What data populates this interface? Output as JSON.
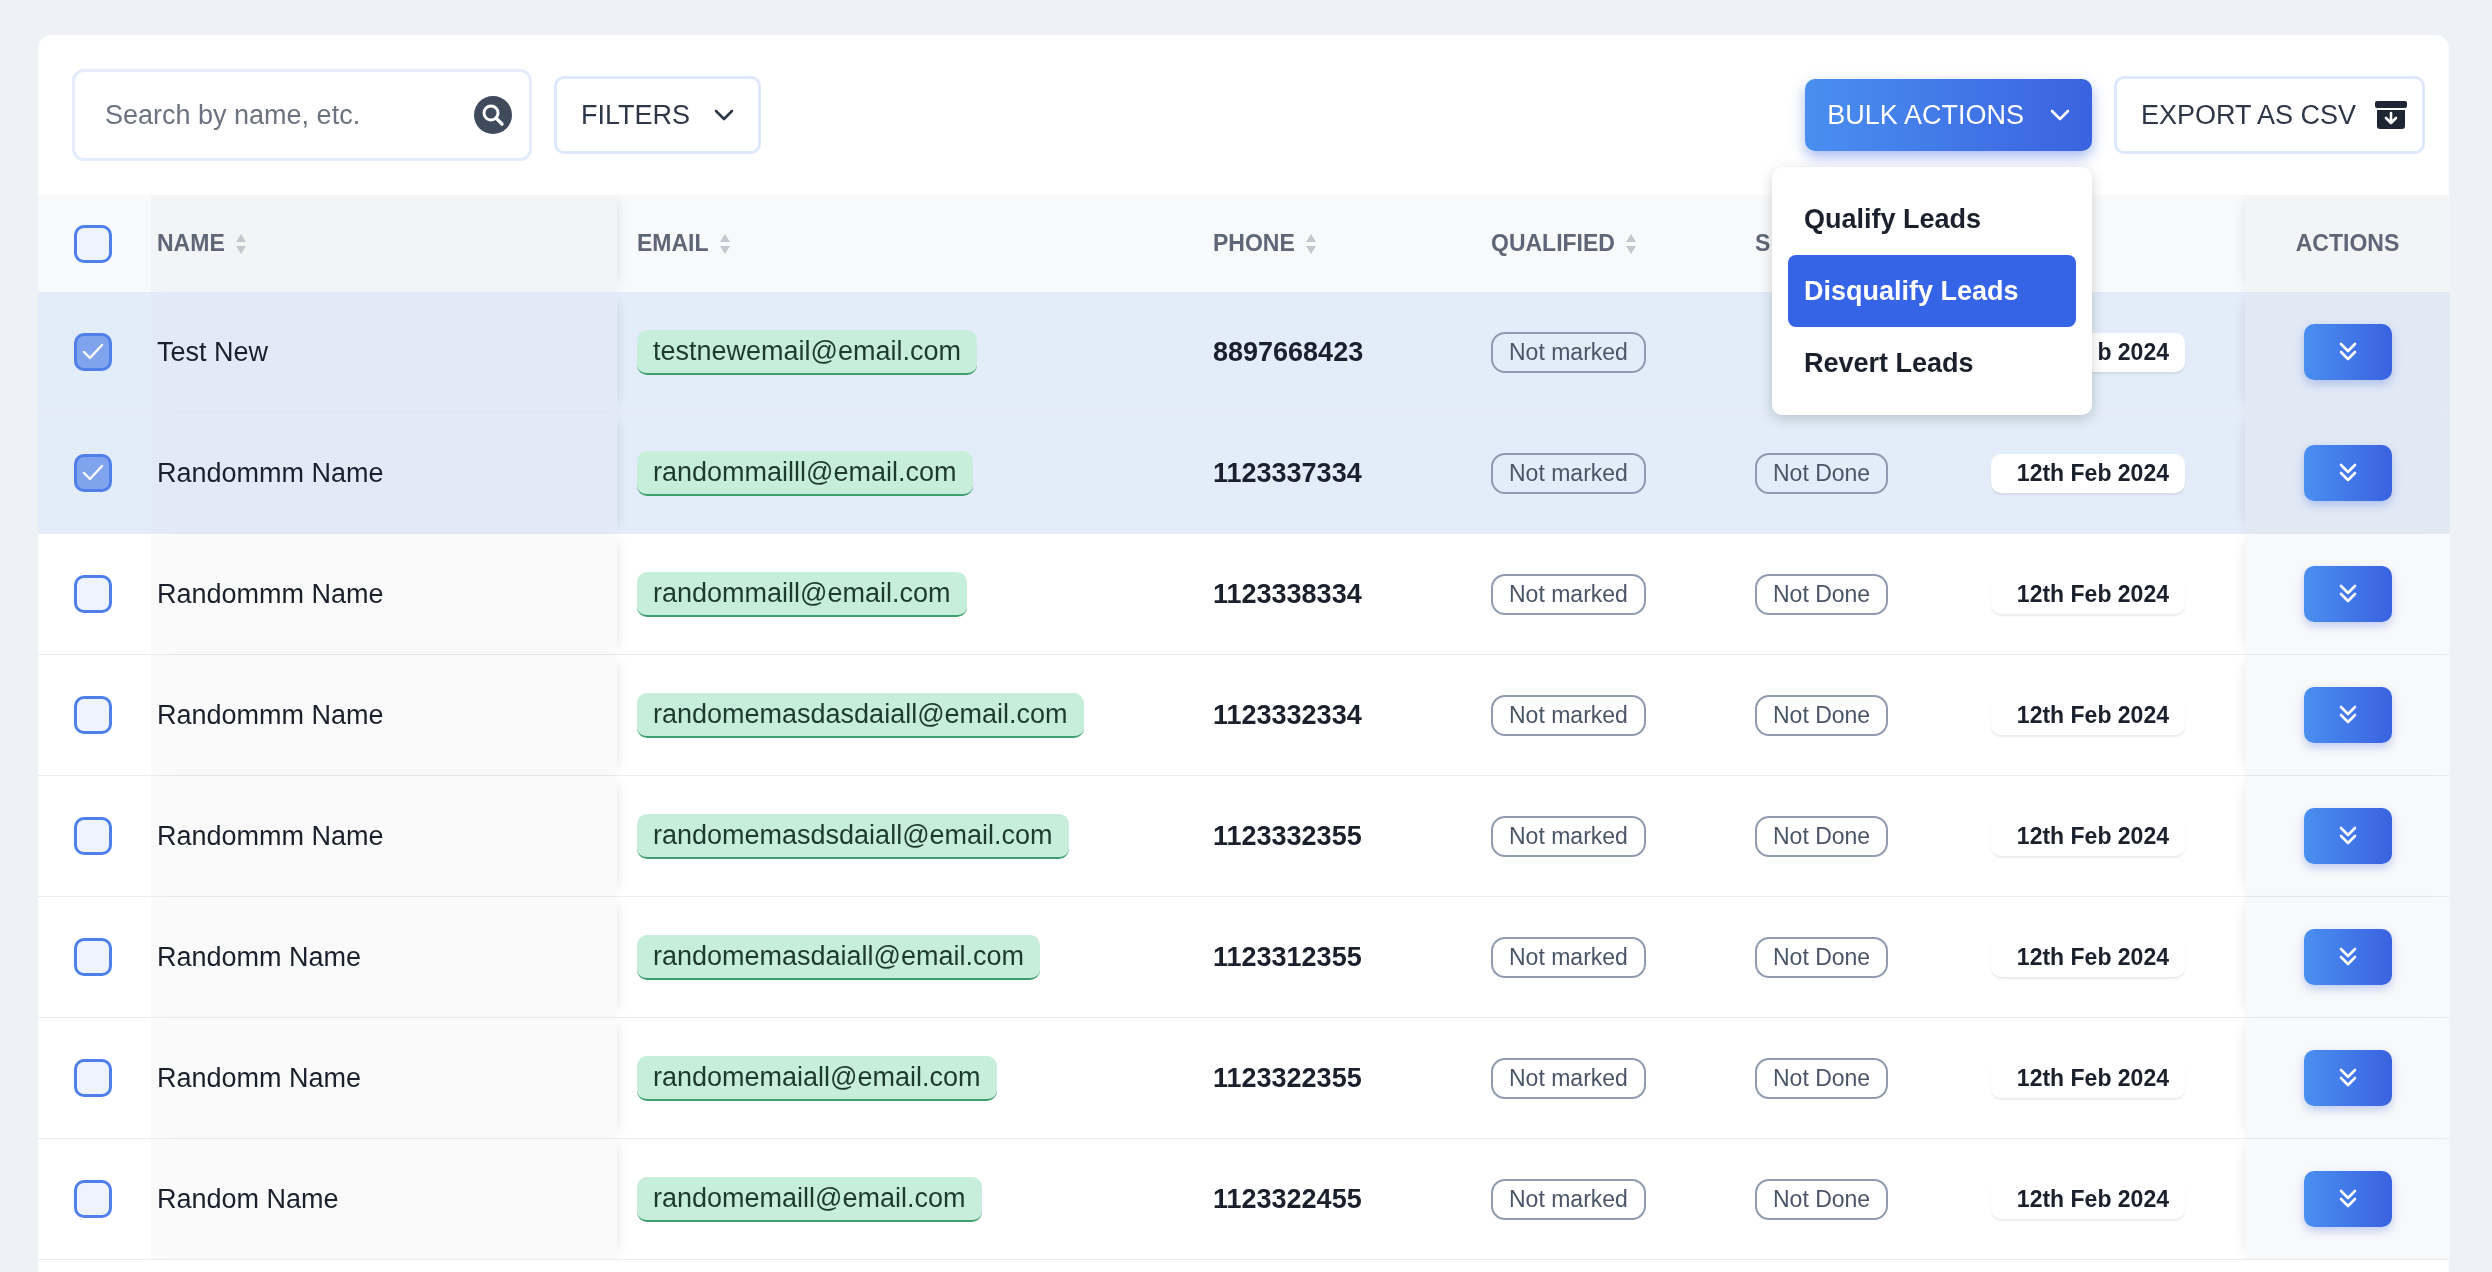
{
  "toolbar": {
    "search": {
      "placeholder": "Search by name, etc."
    },
    "filters_button": "FILTERS",
    "bulk_actions": {
      "label": "BULK ACTIONS",
      "expanded": true,
      "menu": [
        {
          "label": "Qualify Leads",
          "selected": false
        },
        {
          "label": "Disqualify Leads",
          "selected": true
        },
        {
          "label": "Revert Leads",
          "selected": false
        }
      ]
    },
    "export_button": "EXPORT AS CSV"
  },
  "table": {
    "select_all": {
      "checked": false
    },
    "columns": [
      {
        "label": "NAME",
        "sortable": true
      },
      {
        "label": "EMAIL",
        "sortable": true
      },
      {
        "label": "PHONE",
        "sortable": true
      },
      {
        "label": "QUALIFIED",
        "sortable": true
      },
      {
        "label": "S",
        "sortable": false
      },
      {
        "label": "ACTIONS",
        "sortable": false
      }
    ],
    "rows": [
      {
        "checked": true,
        "name": "Test New",
        "email": "testnewemail@email.com",
        "phone": "8897668423",
        "qualified": "Not marked",
        "date": "b 2024"
      },
      {
        "checked": true,
        "name": "Randommm Name",
        "email": "randommailll@email.com",
        "phone": "1123337334",
        "qualified": "Not marked",
        "status": "Not Done",
        "date": "12th Feb 2024"
      },
      {
        "checked": false,
        "name": "Randommm Name",
        "email": "randommaill@email.com",
        "phone": "1123338334",
        "qualified": "Not marked",
        "status": "Not Done",
        "date": "12th Feb 2024"
      },
      {
        "checked": false,
        "name": "Randommm Name",
        "email": "randomemasdasdaiall@email.com",
        "phone": "1123332334",
        "qualified": "Not marked",
        "status": "Not Done",
        "date": "12th Feb 2024"
      },
      {
        "checked": false,
        "name": "Randommm Name",
        "email": "randomemasdsdaiall@email.com",
        "phone": "1123332355",
        "qualified": "Not marked",
        "status": "Not Done",
        "date": "12th Feb 2024"
      },
      {
        "checked": false,
        "name": "Randomm Name",
        "email": "randomemasdaiall@email.com",
        "phone": "1123312355",
        "qualified": "Not marked",
        "status": "Not Done",
        "date": "12th Feb 2024"
      },
      {
        "checked": false,
        "name": "Randomm Name",
        "email": "randomemaiall@email.com",
        "phone": "1123322355",
        "qualified": "Not marked",
        "status": "Not Done",
        "date": "12th Feb 2024"
      },
      {
        "checked": false,
        "name": "Random Name",
        "email": "randomemaill@email.com",
        "phone": "1123322455",
        "qualified": "Not marked",
        "status": "Not Done",
        "date": "12th Feb 2024"
      }
    ]
  }
}
